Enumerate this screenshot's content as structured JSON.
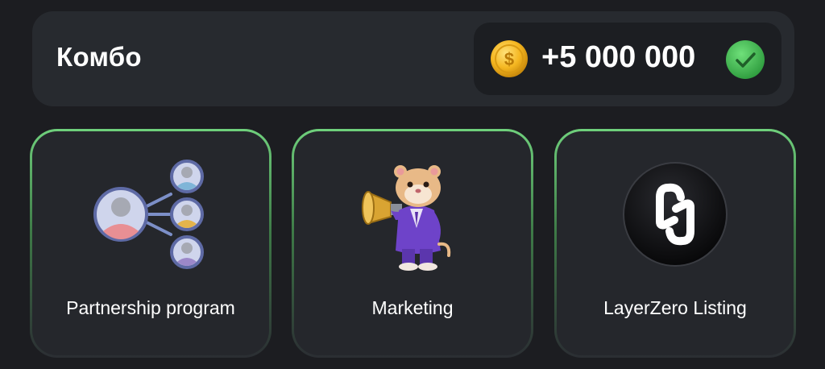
{
  "combo": {
    "title": "Комбо",
    "reward_amount": "+5 000 000",
    "coin_icon": "coin-icon",
    "status_icon": "check-icon",
    "colors": {
      "coin": "#f5b721",
      "check": "#3fbf52"
    }
  },
  "cards": [
    {
      "label": "Partnership program",
      "icon": "partnership-network-icon"
    },
    {
      "label": "Marketing",
      "icon": "hamster-megaphone-illustration"
    },
    {
      "label": "LayerZero Listing",
      "icon": "layerzero-logo"
    }
  ],
  "colors": {
    "background": "#1c1d21",
    "panel": "#272a2f",
    "card_border": "#6fd07c"
  }
}
